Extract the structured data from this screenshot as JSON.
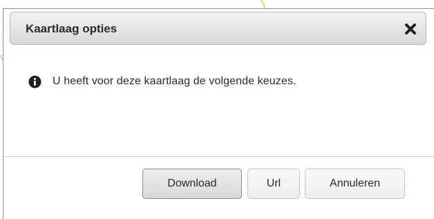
{
  "dialog": {
    "title": "Kaartlaag opties",
    "close_icon": "close-x-icon",
    "message_icon": "info-circle-icon",
    "message": "U heeft voor deze kaartlaag de volgende keuzes."
  },
  "buttons": {
    "download": "Download",
    "url": "Url",
    "cancel": "Annuleren"
  },
  "colors": {
    "titlebar_gradient_top": "#f2f2f2",
    "titlebar_gradient_bottom": "#d9d9d9",
    "text": "#2a2a2a",
    "background_accent_line": "#f0b030"
  }
}
